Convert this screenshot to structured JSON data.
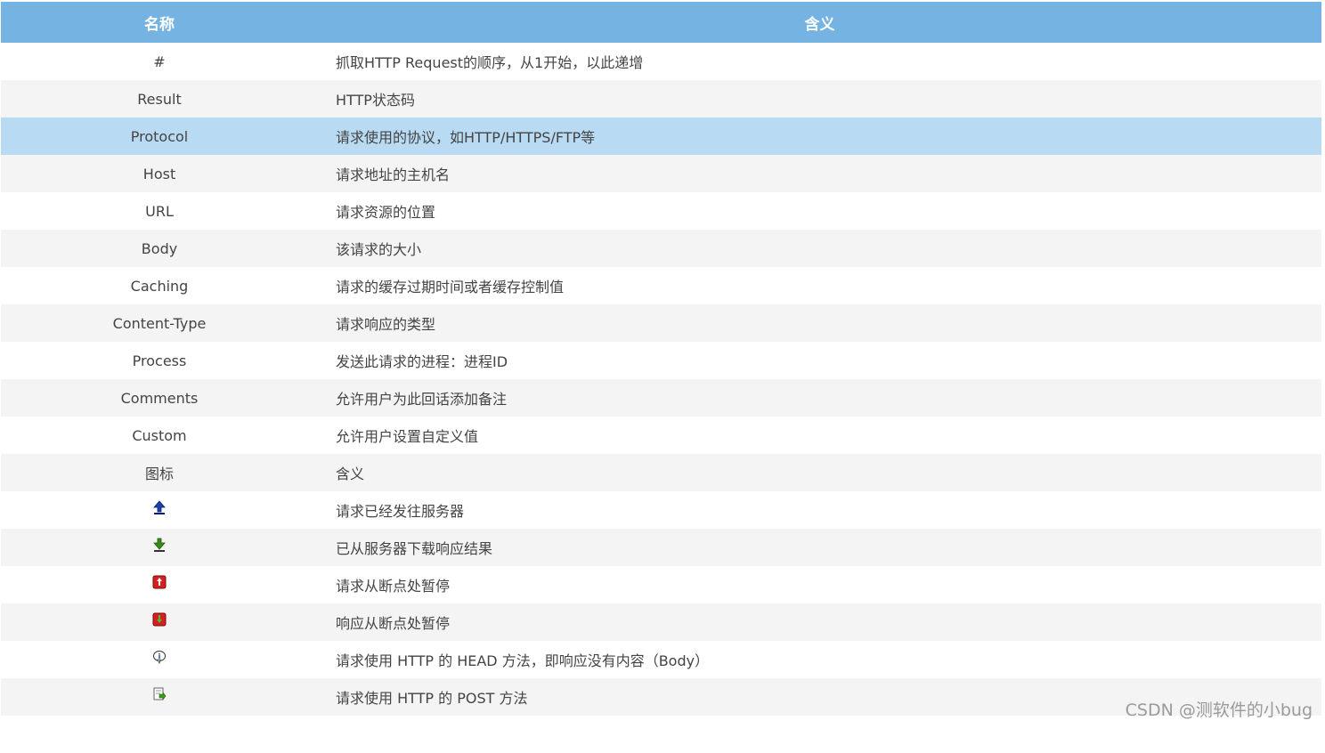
{
  "table": {
    "headers": {
      "name": "名称",
      "meaning": "含义"
    },
    "rows": [
      {
        "name": "#",
        "meaning": "抓取HTTP Request的顺序，从1开始，以此递增"
      },
      {
        "name": "Result",
        "meaning": "HTTP状态码"
      },
      {
        "name": "Protocol",
        "meaning": "请求使用的协议，如HTTP/HTTPS/FTP等"
      },
      {
        "name": "Host",
        "meaning": "请求地址的主机名"
      },
      {
        "name": "URL",
        "meaning": "请求资源的位置"
      },
      {
        "name": "Body",
        "meaning": "该请求的大小"
      },
      {
        "name": "Caching",
        "meaning": "请求的缓存过期时间或者缓存控制值"
      },
      {
        "name": "Content-Type",
        "meaning": "请求响应的类型"
      },
      {
        "name": "Process",
        "meaning": "发送此请求的进程：进程ID"
      },
      {
        "name": "Comments",
        "meaning": "允许用户为此回话添加备注"
      },
      {
        "name": "Custom",
        "meaning": "允许用户设置自定义值"
      },
      {
        "name": "图标",
        "meaning": "含义"
      },
      {
        "icon": "upload-arrow-icon",
        "meaning": "请求已经发往服务器"
      },
      {
        "icon": "download-arrow-icon",
        "meaning": "已从服务器下载响应结果"
      },
      {
        "icon": "request-breakpoint-icon",
        "meaning": "请求从断点处暂停"
      },
      {
        "icon": "response-breakpoint-icon",
        "meaning": "响应从断点处暂停"
      },
      {
        "icon": "head-method-icon",
        "meaning": "请求使用 HTTP 的 HEAD 方法，即响应没有内容（Body）"
      },
      {
        "icon": "post-method-icon",
        "meaning": "请求使用 HTTP 的 POST 方法"
      }
    ]
  },
  "watermark": "CSDN @测软件的小bug",
  "colors": {
    "header_bg": "#74b3e2",
    "row_alt_bg": "#f4f4f4",
    "row_highlight_bg": "#b8daf3"
  }
}
